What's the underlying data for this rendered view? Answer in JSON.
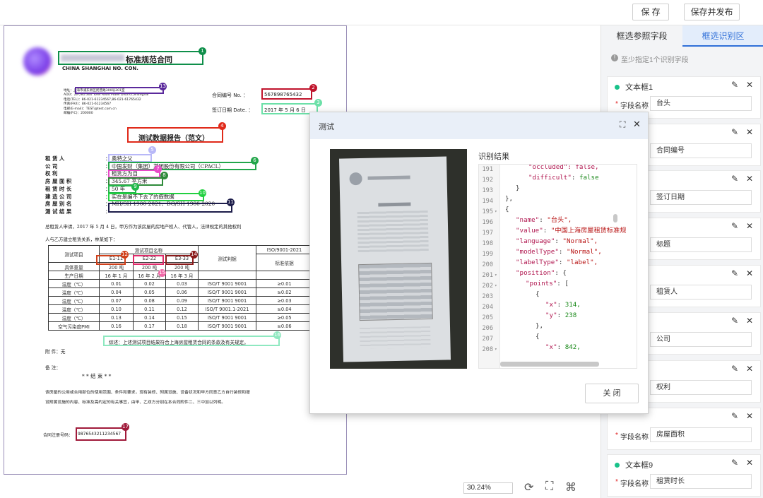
{
  "toolbar": {
    "save": "保 存",
    "save_publish": "保存并发布"
  },
  "zoom": "30.24%",
  "right_panel": {
    "tab_ref": "框选参照字段",
    "tab_rec": "框选识别区",
    "hint": "至少指定1个识别字段",
    "field_label": "字段名称",
    "cards": [
      {
        "title": "文本框1",
        "value": "台头"
      },
      {
        "title": "",
        "value": "合同编号"
      },
      {
        "title": "",
        "value": "签订日期"
      },
      {
        "title": "",
        "value": "标题"
      },
      {
        "title": "",
        "value": "租赁人"
      },
      {
        "title": "",
        "value": "公司"
      },
      {
        "title": "",
        "value": "权利"
      },
      {
        "title": "",
        "value": "房屋面积"
      },
      {
        "title": "文本框9",
        "value": "租赁时长"
      }
    ]
  },
  "modal": {
    "title": "测试",
    "result_label": "识别结果",
    "close_button": "关 闭",
    "line_numbers": [
      "191",
      "192",
      "193",
      "194",
      "195",
      "196",
      "197",
      "198",
      "199",
      "200",
      "201",
      "202",
      "203",
      "204",
      "205",
      "206",
      "207",
      "208"
    ],
    "code": {
      "l191": "\"occluded\": false,",
      "l192a": "\"difficult\"",
      "l192b": ": ",
      "l192c": "false",
      "l193": "}",
      "l194": "},",
      "l195": "{",
      "l196a": "\"name\"",
      "l196b": ": ",
      "l196c": "\"台头\",",
      "l197a": "\"value\"",
      "l197b": ": ",
      "l197c": "\"中国上海房屋租赁标准规",
      "l198a": "\"language\"",
      "l198b": ": ",
      "l198c": "\"Normal\",",
      "l199a": "\"modelType\"",
      "l199b": ": ",
      "l199c": "\"Normal\",",
      "l200a": "\"labelType\"",
      "l200b": ": ",
      "l200c": "\"label\",",
      "l201a": "\"position\"",
      "l201b": ": {",
      "l202a": "\"points\"",
      "l202b": ": [",
      "l203": "{",
      "l204a": "\"x\"",
      "l204b": ": ",
      "l204c": "314,",
      "l205a": "\"y\"",
      "l205b": ": ",
      "l205c": "238",
      "l206": "},",
      "l207": "{",
      "l208a": "\"x\"",
      "l208b": ": ",
      "l208c": "842,"
    }
  },
  "document": {
    "title_suffix": "标准规范合同",
    "title_en": "CHINA SHANGHAI NO. CON.",
    "addr_lines": [
      "地址：上海市浦东新区民营路300号201室",
      "ADD：2/F,NO.300 Tofei Road Pubei District,Shanghai",
      "电话(TEL)：86-021-61234567,86-021-61765432",
      "传真(FAX)：86-021-61234567",
      "电邮(E-mail)：TEST@test.com.cn",
      "邮编(P.C)：200000"
    ],
    "contract_no_label": "合同编号    No.   ：",
    "contract_no": "567898765432",
    "sign_date_label": "签订日期   Date.  ：",
    "sign_date": "2017 年 5 月 6 日",
    "report_title": "测试数据报告（范文）",
    "rows": [
      {
        "label": "租        赁        人",
        "value": "奥特之父"
      },
      {
        "label": "公                  司",
        "value": "中国发财（集团）某团股份有限公司（CPACL）"
      },
      {
        "label": "权                  利",
        "value": "租赁方为自"
      },
      {
        "label": "房   屋   面   积",
        "value": "345.67 平方米"
      },
      {
        "label": "租   赁   时   长",
        "value": "50 年"
      },
      {
        "label": "建   造   公   司",
        "value": "实在是编不下去了的假数据"
      },
      {
        "label": "房   屋   别   名",
        "value": "MH/SH 1900-2021、DG/SH 1900-2020"
      },
      {
        "label": "测   试   结   果",
        "value": ""
      }
    ],
    "para1": "总租赁人申请，2017 年 5 月 4 日，甲方作为该房屋的房地产权人、代管人，法律规定的其他权利",
    "para2": "人与乙方建立租赁关系，林某如下：",
    "table_head": [
      "测试项目",
      "测试项目名称",
      "测试判据",
      "ISO/9001-2021"
    ],
    "table_head2": [
      "E1-11",
      "E2-22",
      "E3-33",
      "标准依据"
    ],
    "table_rows": [
      [
        "具体重量",
        "200 吨",
        "200 吨",
        "200 吨",
        "",
        ""
      ],
      [
        "生产日期",
        "16 年 1 月",
        "16 年 2 月",
        "16 年 3 月",
        "",
        ""
      ],
      [
        "温度（℃）",
        "0.01",
        "0.02",
        "0.03",
        "ISO/T 9001 9001",
        "≥0.01"
      ],
      [
        "温度（℃）",
        "0.04",
        "0.05",
        "0.06",
        "ISO/T 9001 9001",
        "≥0.02"
      ],
      [
        "温度（℃）",
        "0.07",
        "0.08",
        "0.09",
        "ISO/T 9001 9001",
        "≥0.03"
      ],
      [
        "温度（℃）",
        "0.10",
        "0.11",
        "0.12",
        "ISO/T 9001.1-2021",
        "≥0.04"
      ],
      [
        "温度（℃）",
        "0.13",
        "0.14",
        "0.15",
        "ISO/T 9001 9001",
        "≥0.05"
      ],
      [
        "空气污染度PMI",
        "0.16",
        "0.17",
        "0.18",
        "ISO/T 9001 9001",
        "≥0.06"
      ]
    ],
    "conclusion": "综述：上述测试项目结果符合上海房屋租赁合同的条款及有关规定。",
    "attach": "附      件：无",
    "remark": "备      注：",
    "end_line": "*          *          结          束          *          *",
    "foot1": "该房屋的公用或合用部位的使用范围、条件和要求，现有装修、附属设施、设备状况和甲方同意乙方自行装修和增",
    "foot2": "设附属设施的内容、标准及需约定的有关事宜，由甲、乙双方分别在本合同附件二、三中加以列明。",
    "reg_label": "合同注册号码：",
    "reg_no": "9876543211234567",
    "markers": [
      "1",
      "2",
      "3",
      "4",
      "5",
      "6",
      "7",
      "8",
      "9",
      "10",
      "11",
      "12",
      "13",
      "14",
      "15",
      "16",
      "17",
      "18"
    ]
  }
}
